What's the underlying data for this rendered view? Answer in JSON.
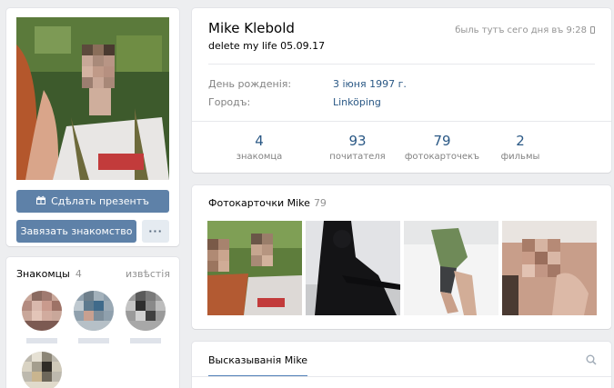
{
  "profile": {
    "name": "Mike Klebold",
    "status": "delete my life 05.09.17",
    "online": "быль тутъ сего дня въ 9:28",
    "info": [
      {
        "key": "День рожденія:",
        "value": "3 іюня 1997 г."
      },
      {
        "key": "Городъ:",
        "value": "Linköping"
      }
    ],
    "counters": [
      {
        "value": "4",
        "label": "знакомца"
      },
      {
        "value": "93",
        "label": "почитателя"
      },
      {
        "value": "79",
        "label": "фотокарточекъ"
      },
      {
        "value": "2",
        "label": "фильмы"
      }
    ]
  },
  "actions": {
    "gift_label": "Сдѣлать презентъ",
    "friend_label": "Завязать знакомство",
    "more_label": "···"
  },
  "friends": {
    "title": "Знакомцы",
    "count": "4",
    "link": "извѣстія"
  },
  "photos": {
    "title": "Фотокарточки Mike",
    "count": "79"
  },
  "wall": {
    "tab": "Высказыванія Mike"
  },
  "colors": {
    "accent": "#5e81a8",
    "link": "#2a5885",
    "muted": "#828282",
    "background": "#edeef0"
  },
  "icons": {
    "gift": "gift-icon",
    "phone": "phone-icon",
    "search": "search-icon"
  }
}
